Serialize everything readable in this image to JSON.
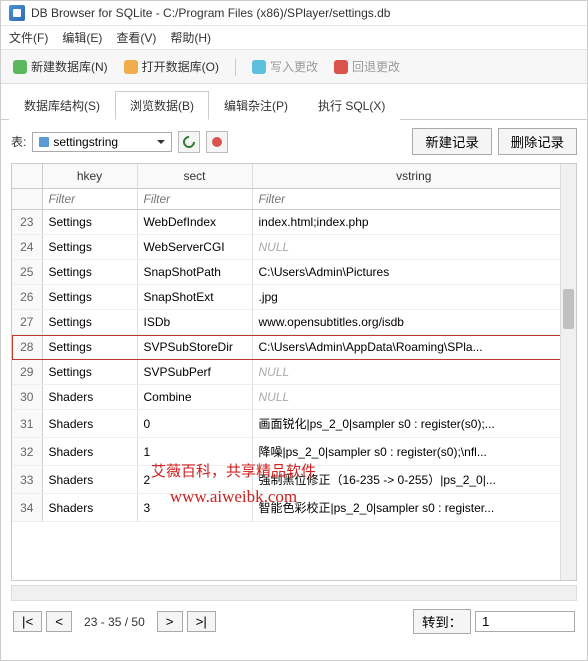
{
  "title": "DB Browser for SQLite - C:/Program Files (x86)/SPlayer/settings.db",
  "menu": {
    "file": "文件(F)",
    "edit": "编辑(E)",
    "view": "查看(V)",
    "help": "帮助(H)"
  },
  "toolbar": {
    "new_db": "新建数据库(N)",
    "open_db": "打开数据库(O)",
    "write_changes": "写入更改",
    "revert_changes": "回退更改"
  },
  "tabs": {
    "structure": "数据库结构(S)",
    "browse": "浏览数据(B)",
    "edit_pragmas": "编辑杂注(P)",
    "exec_sql": "执行 SQL(X)"
  },
  "subbar": {
    "label": "表:",
    "selected_table": "settingstring",
    "new_record": "新建记录",
    "delete_record": "删除记录"
  },
  "columns": {
    "hkey": "hkey",
    "sect": "sect",
    "vstring": "vstring"
  },
  "filter_placeholder": "Filter",
  "rows": [
    {
      "n": 23,
      "hkey": "Settings",
      "sect": "WebDefIndex",
      "vstring": "index.html;index.php"
    },
    {
      "n": 24,
      "hkey": "Settings",
      "sect": "WebServerCGI",
      "vstring": null
    },
    {
      "n": 25,
      "hkey": "Settings",
      "sect": "SnapShotPath",
      "vstring": "C:\\Users\\Admin\\Pictures"
    },
    {
      "n": 26,
      "hkey": "Settings",
      "sect": "SnapShotExt",
      "vstring": ".jpg"
    },
    {
      "n": 27,
      "hkey": "Settings",
      "sect": "ISDb",
      "vstring": "www.opensubtitles.org/isdb"
    },
    {
      "n": 28,
      "hkey": "Settings",
      "sect": "SVPSubStoreDir",
      "vstring": "C:\\Users\\Admin\\AppData\\Roaming\\SPla...",
      "selected": true
    },
    {
      "n": 29,
      "hkey": "Settings",
      "sect": "SVPSubPerf",
      "vstring": null
    },
    {
      "n": 30,
      "hkey": "Shaders",
      "sect": "Combine",
      "vstring": null
    },
    {
      "n": 31,
      "hkey": "Shaders",
      "sect": "0",
      "vstring": "画面锐化|ps_2_0|sampler s0 : register(s0);..."
    },
    {
      "n": 32,
      "hkey": "Shaders",
      "sect": "1",
      "vstring": "降噪|ps_2_0|sampler s0 : register(s0);\\nfl..."
    },
    {
      "n": 33,
      "hkey": "Shaders",
      "sect": "2",
      "vstring": "强制黑位修正（16-235 -> 0-255）|ps_2_0|..."
    },
    {
      "n": 34,
      "hkey": "Shaders",
      "sect": "3",
      "vstring": "智能色彩校正|ps_2_0|sampler s0 : register..."
    }
  ],
  "pager": {
    "first": "|<",
    "prev": "<",
    "info": "23 - 35 / 50",
    "next": ">",
    "last": ">|",
    "goto_label": "转到：",
    "goto_value": "1"
  },
  "watermark": {
    "line1": "艾薇百科，共享精品软件",
    "line2": "www.aiweibk.com"
  },
  "null_text": "NULL"
}
